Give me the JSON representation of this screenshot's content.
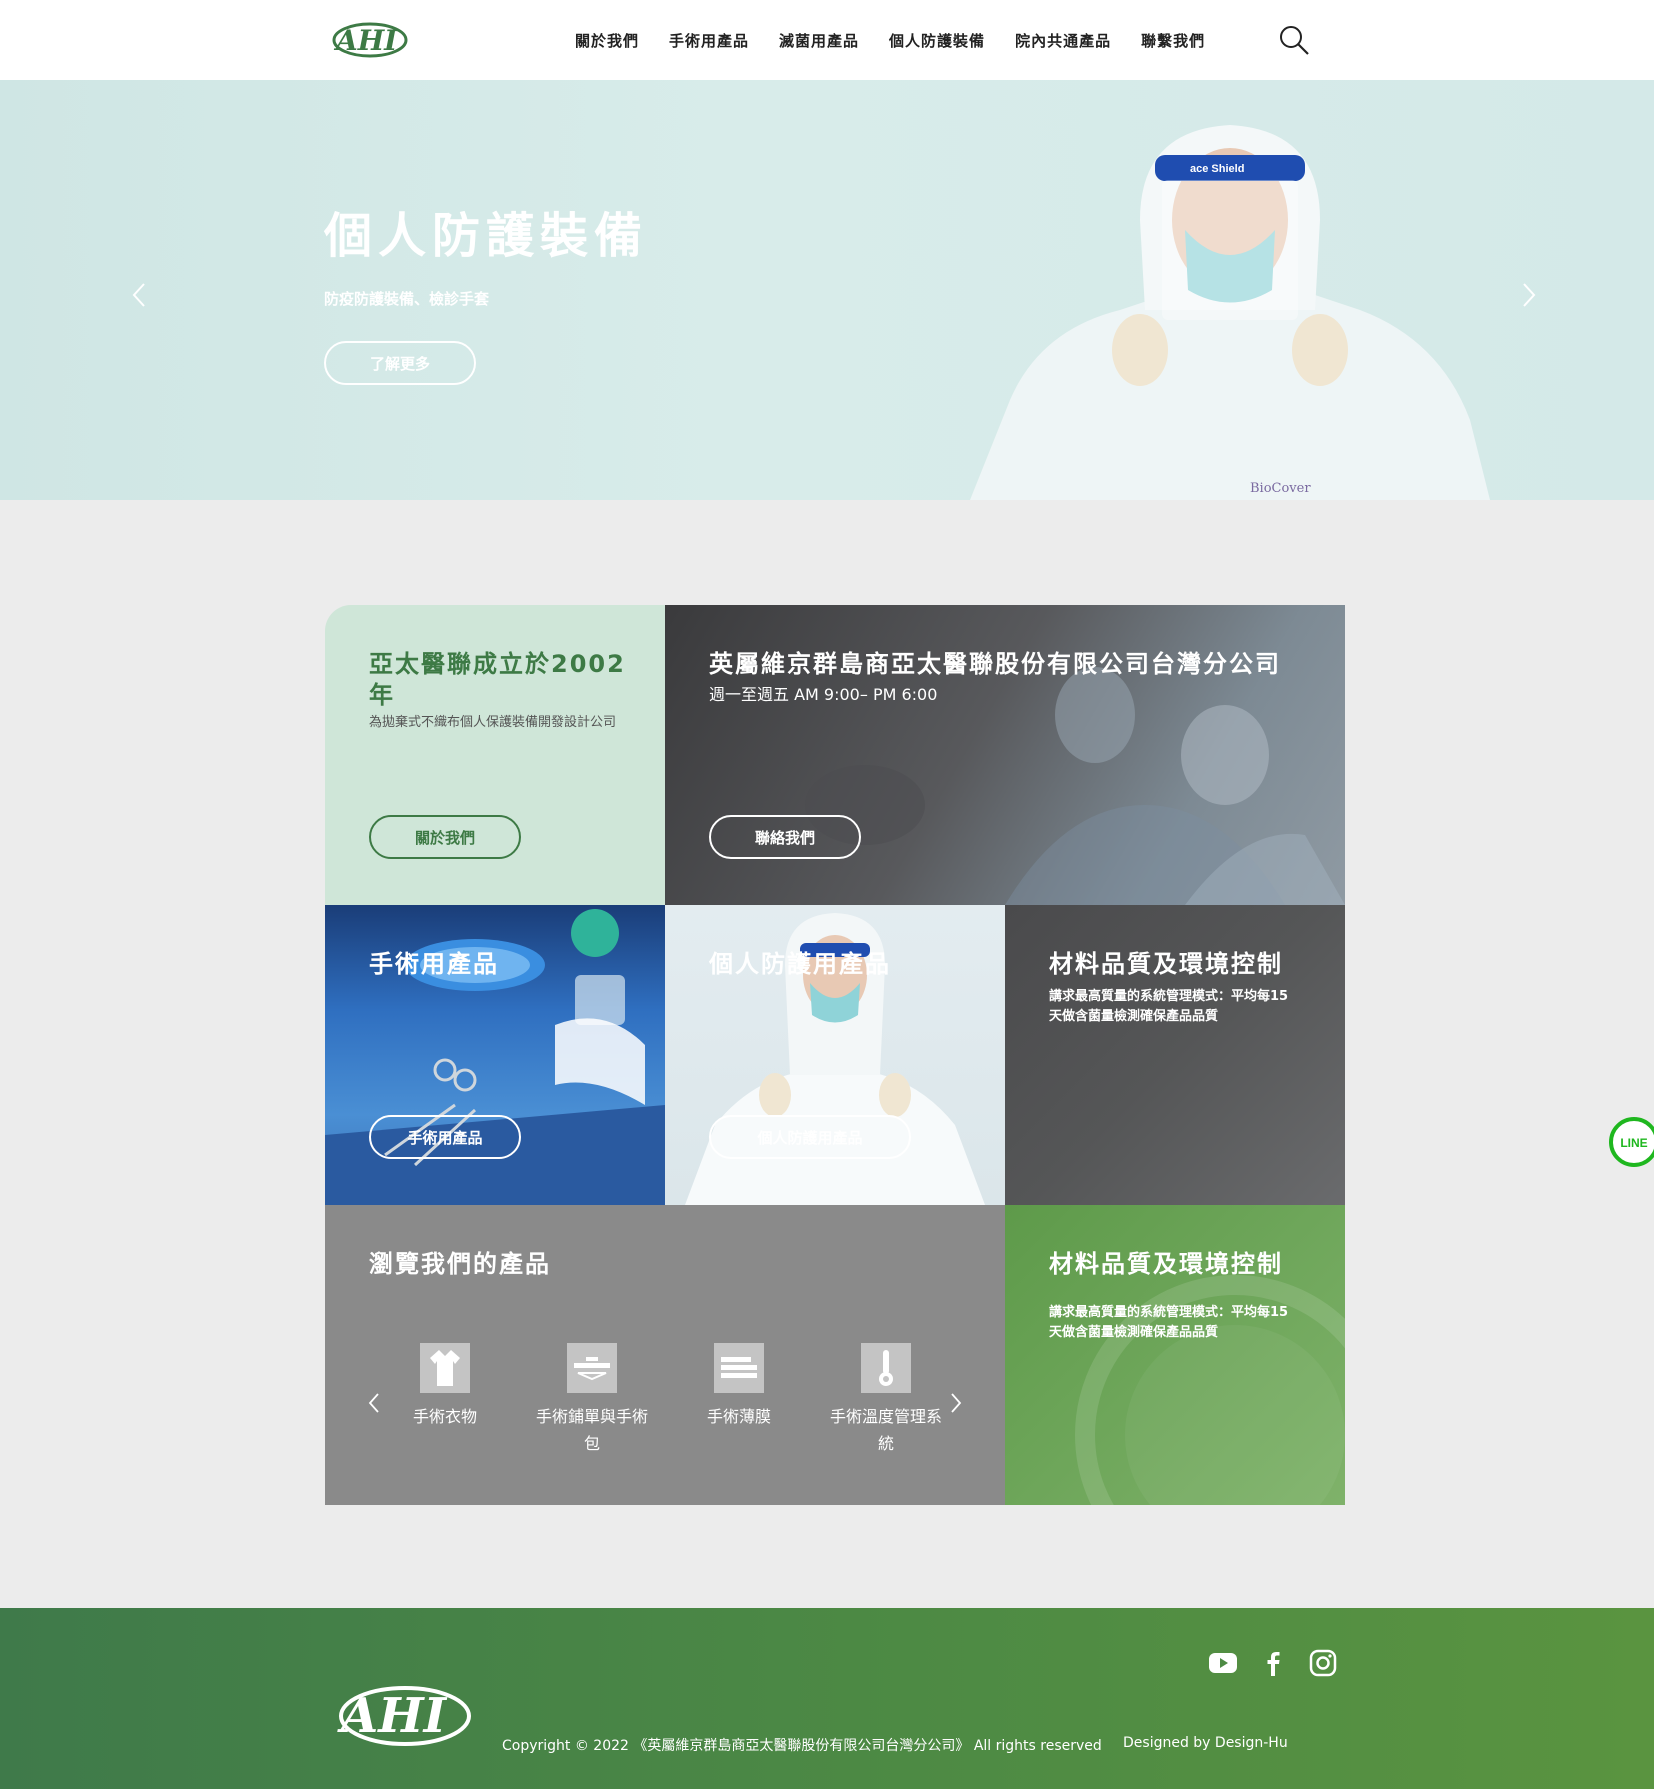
{
  "brand": {
    "logo_text": "AHI"
  },
  "nav": {
    "items": [
      {
        "label": "關於我們"
      },
      {
        "label": "手術用產品"
      },
      {
        "label": "滅菌用產品"
      },
      {
        "label": "個人防護裝備"
      },
      {
        "label": "院內共通產品"
      },
      {
        "label": "聯繫我們"
      }
    ]
  },
  "hero": {
    "title": "個人防護裝備",
    "subtitle": "防疫防護裝備、檢診手套",
    "button": "了解更多",
    "image_text": {
      "shield": "ace Shield",
      "suit": "BioCover"
    }
  },
  "about": {
    "title": "亞太醫聯成立於2002年",
    "desc": "為拋棄式不織布個人保護裝備開發設計公司",
    "button": "關於我們"
  },
  "contact": {
    "title": "英屬維京群島商亞太醫聯股份有限公司台灣分公司",
    "hours": "週一至週五 AM 9:00– PM 6:00",
    "button": "聯絡我們"
  },
  "surgical": {
    "title": "手術用產品",
    "button": "手術用產品"
  },
  "ppe": {
    "title": "個人防護用產品",
    "button": "個人防護用產品"
  },
  "quality": {
    "title": "材料品質及環境控制",
    "desc": "講求最高質量的系統管理模式：平均每15天做含菌量檢測確保產品品質"
  },
  "browse": {
    "title": "瀏覽我們的產品",
    "products": [
      {
        "label": "手術衣物",
        "icon": "gown-icon"
      },
      {
        "label": "手術鋪單與手術包",
        "icon": "surgical-drape-icon"
      },
      {
        "label": "手術薄膜",
        "icon": "film-icon"
      },
      {
        "label": "手術溫度管理系統",
        "icon": "thermometer-icon"
      }
    ]
  },
  "quality2": {
    "title": "材料品質及環境控制",
    "desc": "講求最高質量的系統管理模式：平均每15天做含菌量檢測確保產品品質"
  },
  "line_badge": "LINE",
  "footer": {
    "copyright": "Copyright © 2022 《英屬維京群島商亞太醫聯股份有限公司台灣分公司》 All rights reserved",
    "designer": "Designed by Design-Hu",
    "socials": [
      "youtube-icon",
      "facebook-icon",
      "instagram-icon"
    ]
  },
  "colors": {
    "brand_green": "#3d7a45",
    "mint": "#cfe6d8",
    "footer_green": "#4d8a44"
  }
}
